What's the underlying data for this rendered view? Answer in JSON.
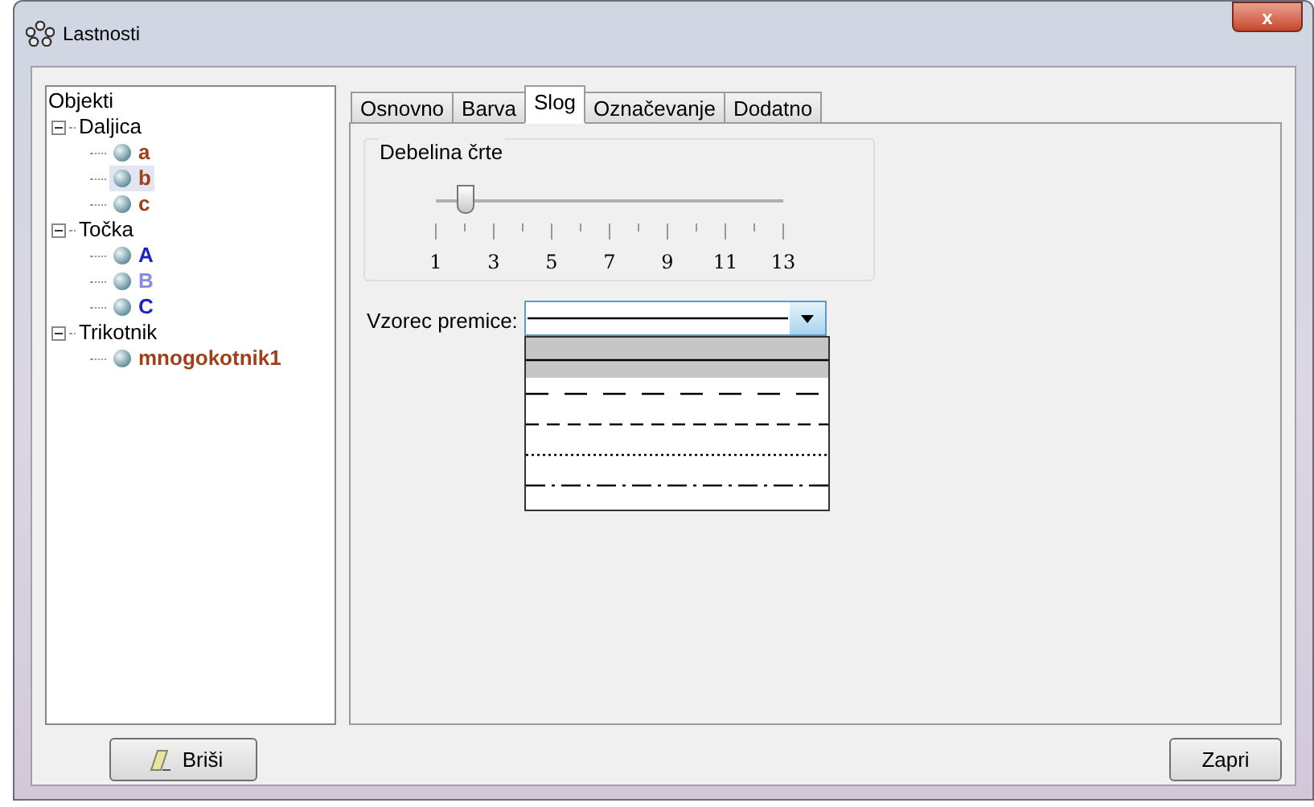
{
  "window": {
    "title": "Lastnosti",
    "close": "x"
  },
  "tree": {
    "root": "Objekti",
    "children": [
      {
        "label": "Daljica",
        "expanded": true,
        "children": [
          {
            "label": "a",
            "color": "#a0401a",
            "selected": false
          },
          {
            "label": "b",
            "color": "#a0401a",
            "selected": true
          },
          {
            "label": "c",
            "color": "#a0401a",
            "selected": false
          }
        ]
      },
      {
        "label": "Točka",
        "expanded": true,
        "children": [
          {
            "label": "A",
            "color": "#1f1fc8",
            "selected": false
          },
          {
            "label": "B",
            "color": "#8a8ae6",
            "selected": false
          },
          {
            "label": "C",
            "color": "#1f1fc8",
            "selected": false
          }
        ]
      },
      {
        "label": "Trikotnik",
        "expanded": true,
        "children": [
          {
            "label": "mnogokotnik1",
            "color": "#a0401a",
            "selected": false
          }
        ]
      }
    ]
  },
  "tabs": [
    {
      "label": "Osnovno",
      "selected": false
    },
    {
      "label": "Barva",
      "selected": false
    },
    {
      "label": "Slog",
      "selected": true
    },
    {
      "label": "Označevanje",
      "selected": false
    },
    {
      "label": "Dodatno",
      "selected": false
    }
  ],
  "thickness": {
    "title": "Debelina črte",
    "level": 0.083,
    "ticks": [
      "1",
      "3",
      "5",
      "7",
      "9",
      "11",
      "13"
    ]
  },
  "line_style": {
    "label": "Vzorec premice:",
    "options": [
      {
        "kind": "solid",
        "selected": true
      },
      {
        "kind": "long-dash",
        "selected": false
      },
      {
        "kind": "dash",
        "selected": false
      },
      {
        "kind": "dot",
        "selected": false
      },
      {
        "kind": "dash-dot",
        "selected": false
      }
    ]
  },
  "buttons": {
    "delete": "Briši",
    "close": "Zapri"
  }
}
